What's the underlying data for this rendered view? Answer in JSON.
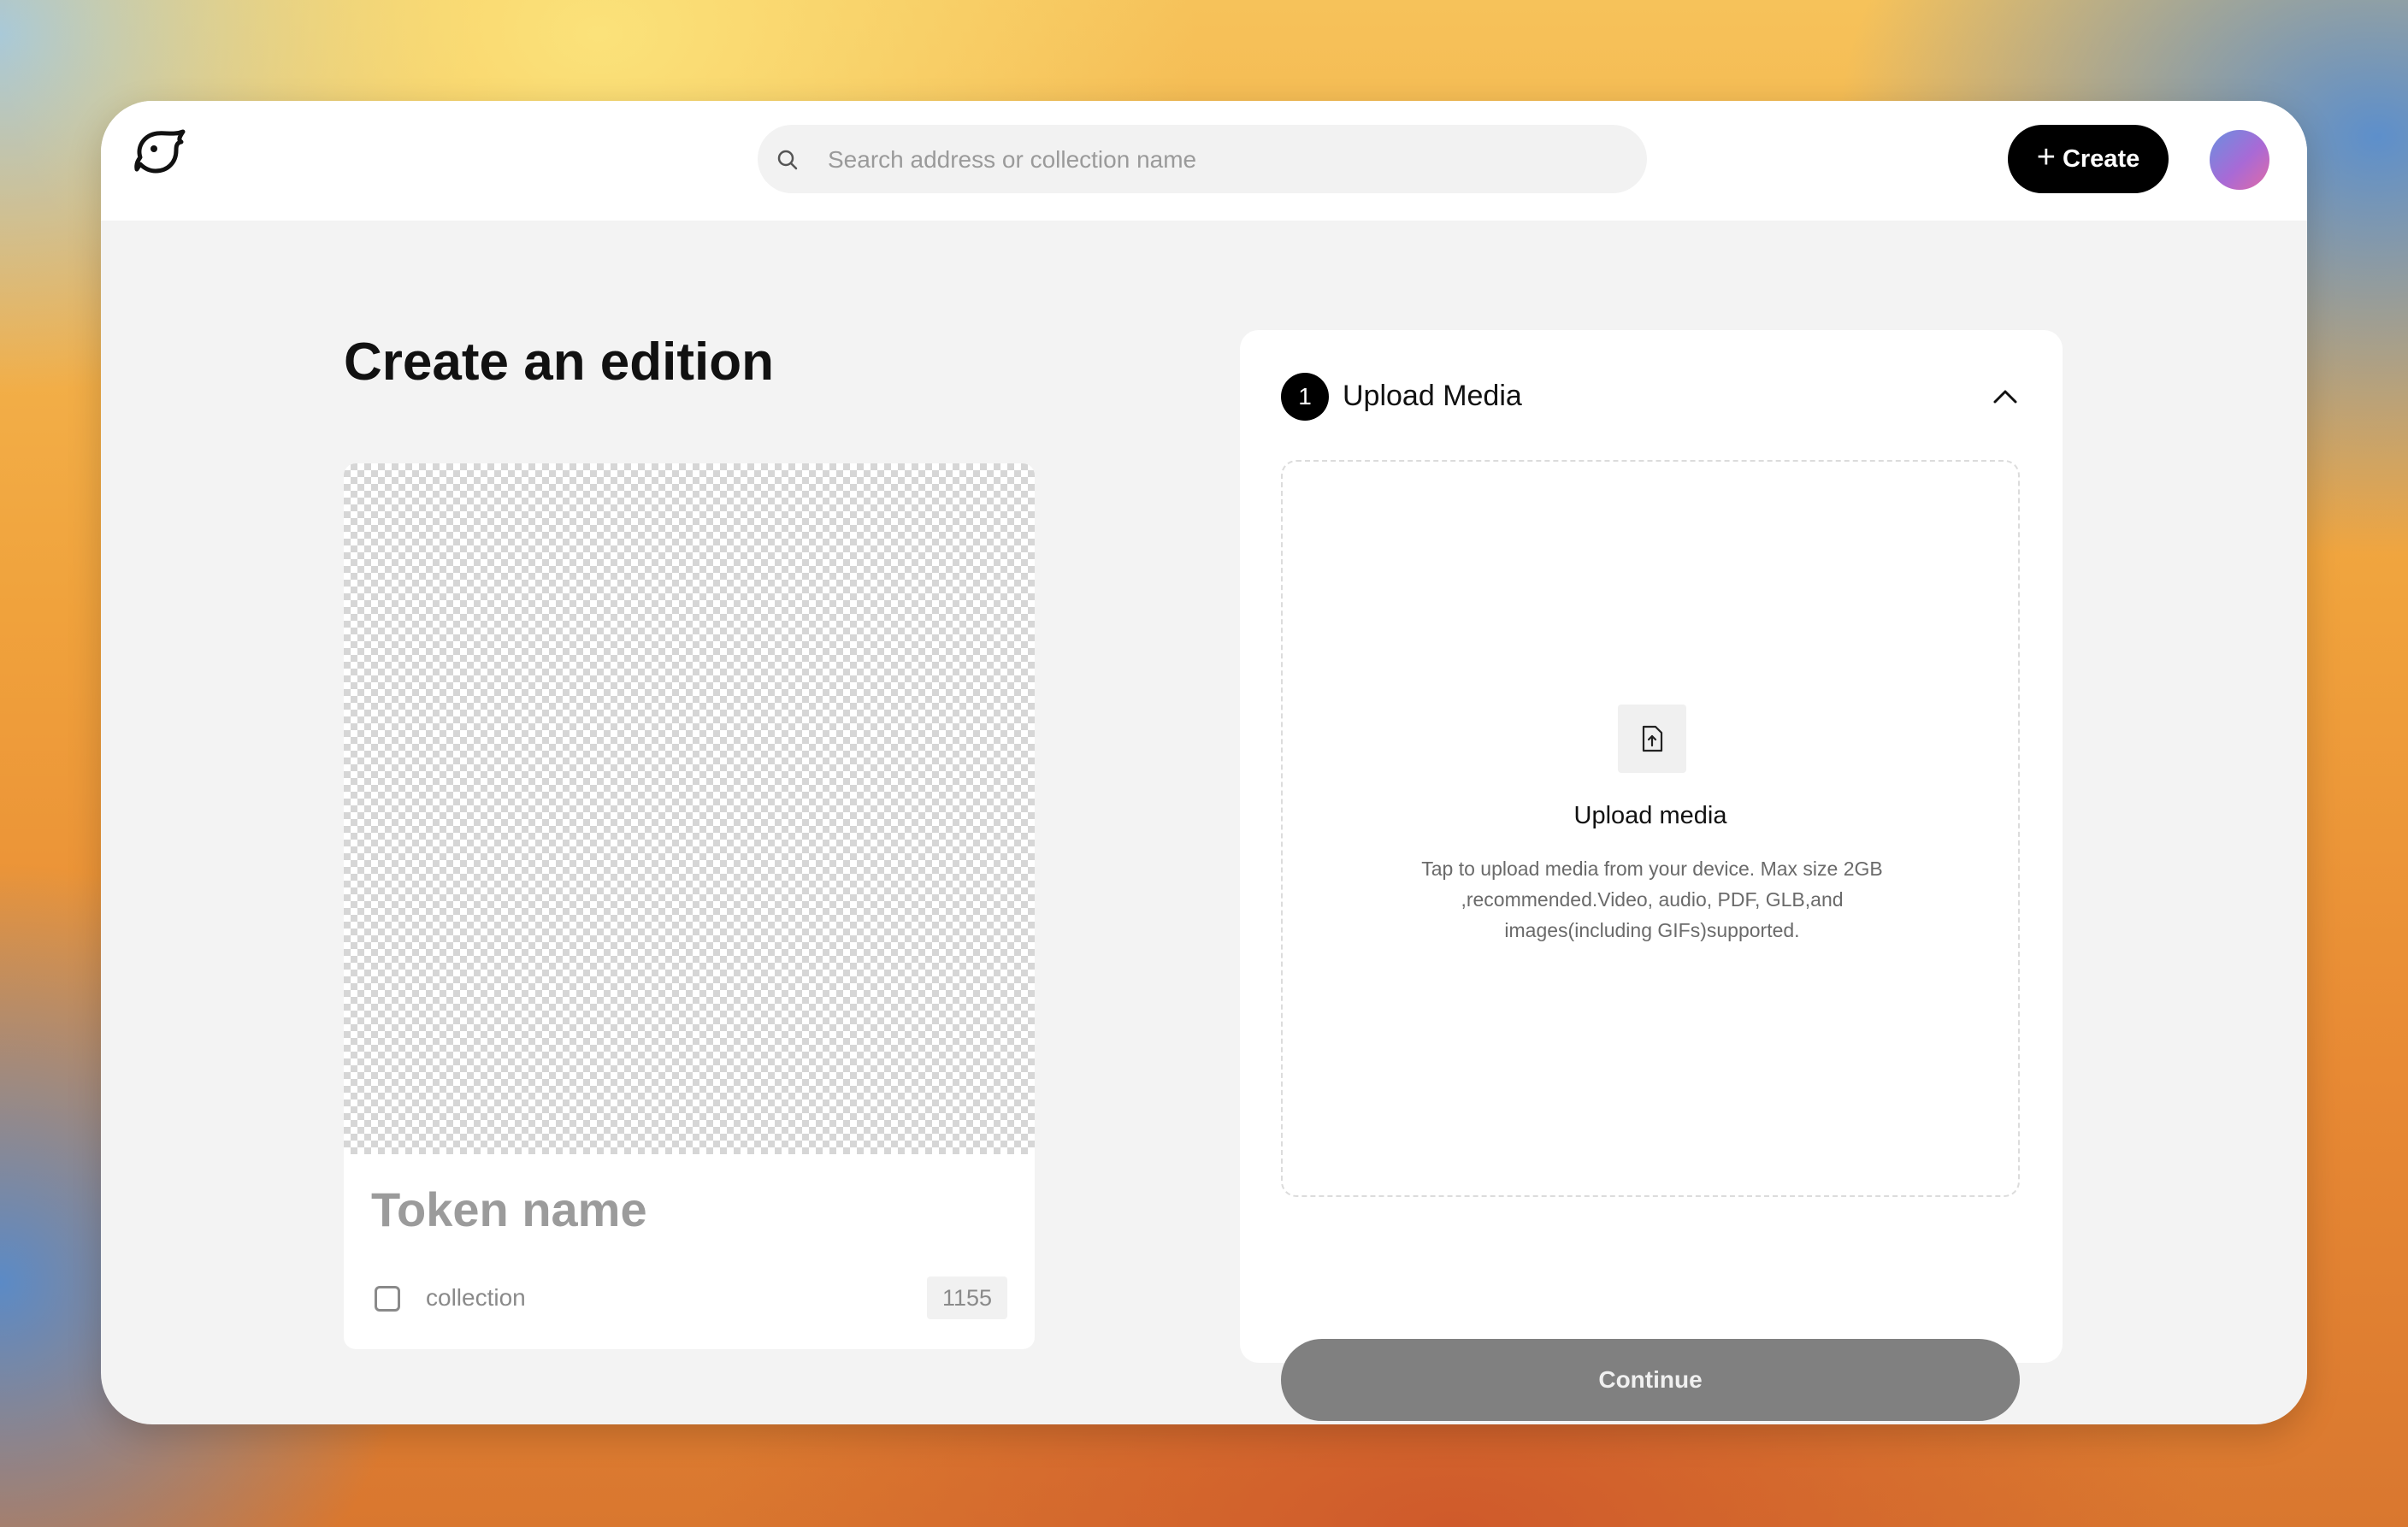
{
  "header": {
    "logo_icon": "bird-logo-icon",
    "search": {
      "placeholder": "Search address or collection name",
      "icon": "search-icon"
    },
    "create_button": {
      "icon": "plus-icon",
      "label": "Create"
    },
    "avatar": "avatar"
  },
  "main": {
    "title": "Create an edition",
    "preview": {
      "token_name": "Token name",
      "collection_label": "collection",
      "collection_checked": false,
      "count": "1155"
    },
    "upload": {
      "step_number": "1",
      "step_title": "Upload Media",
      "collapse_icon": "chevron-up-icon",
      "dropzone_icon": "file-upload-icon",
      "dropzone_title": "Upload media",
      "dropzone_description": "Tap to upload media from your device. Max size 2GB ,recommended.Video, audio, PDF, GLB,and images(including GIFs)supported.",
      "continue_label": "Continue"
    }
  },
  "colors": {
    "primary": "#000000",
    "disabled_button": "#808080",
    "page_background": "#f3f3f3"
  }
}
